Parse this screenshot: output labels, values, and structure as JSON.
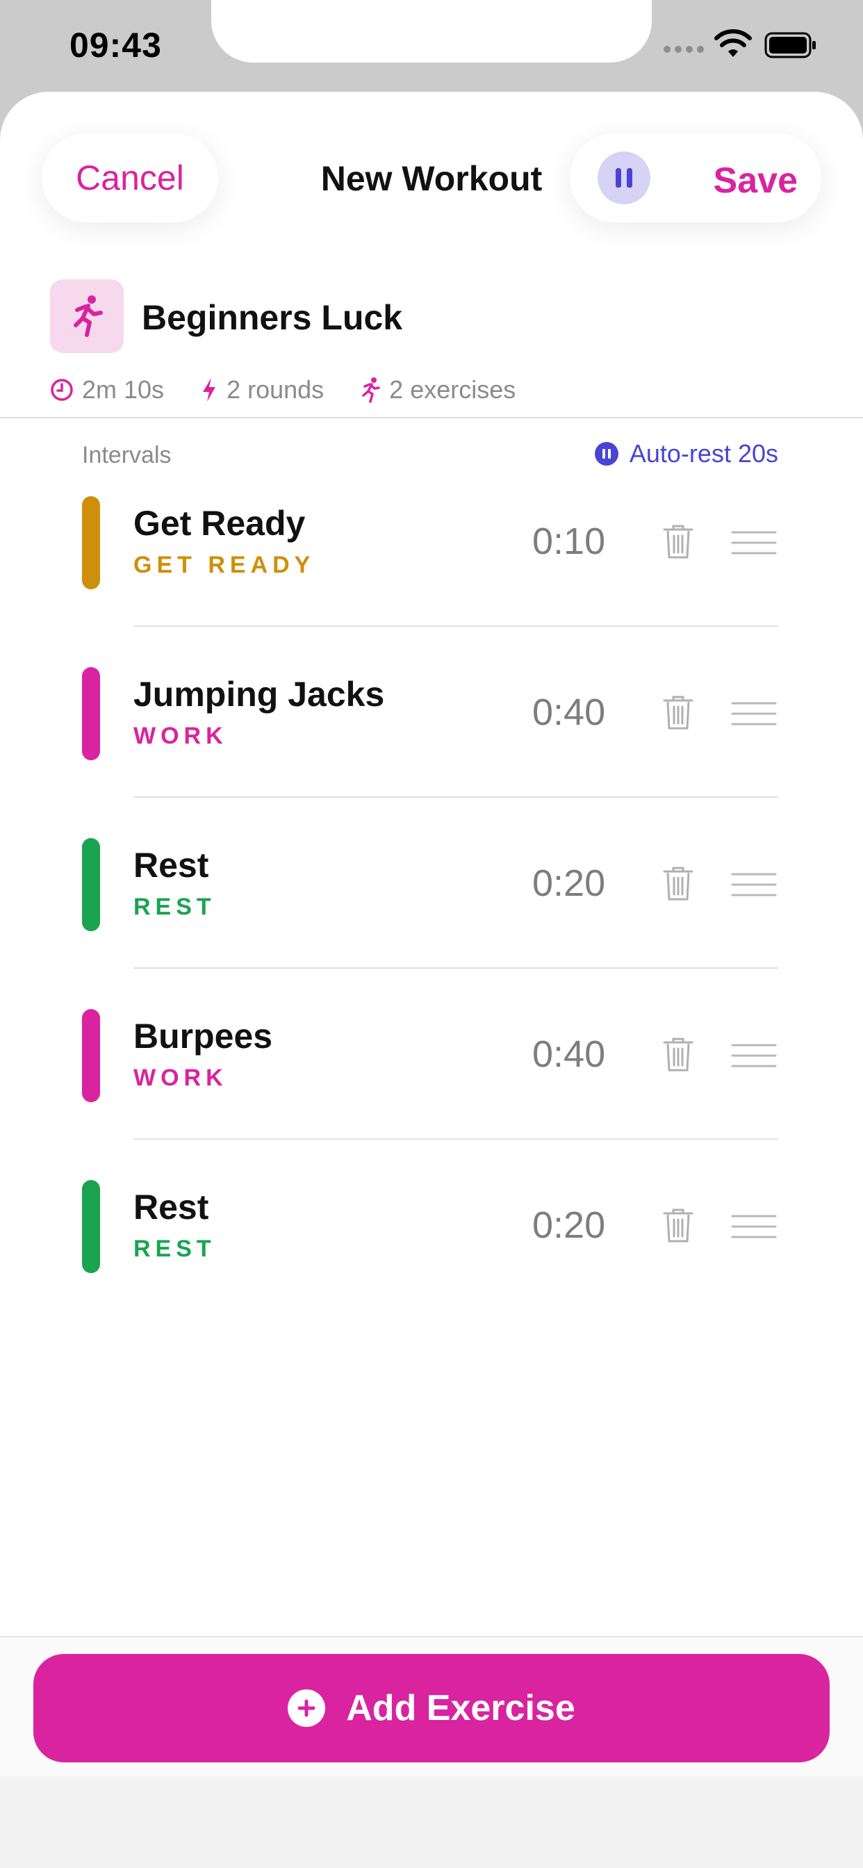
{
  "status_bar": {
    "time": "09:43"
  },
  "nav": {
    "cancel_label": "Cancel",
    "title": "New Workout",
    "save_label": "Save"
  },
  "workout": {
    "name": "Beginners Luck",
    "duration": "2m 10s",
    "rounds": "2 rounds",
    "exercises": "2 exercises"
  },
  "intervals": {
    "label": "Intervals",
    "autorest_label": "Auto-rest 20s",
    "items": [
      {
        "name": "Get Ready",
        "kind": "GET READY",
        "time": "0:10",
        "color": "#d08f0a"
      },
      {
        "name": "Jumping Jacks",
        "kind": "WORK",
        "time": "0:40",
        "color": "#d9239f"
      },
      {
        "name": "Rest",
        "kind": "REST",
        "time": "0:20",
        "color": "#1aa351"
      },
      {
        "name": "Burpees",
        "kind": "WORK",
        "time": "0:40",
        "color": "#d9239f"
      },
      {
        "name": "Rest",
        "kind": "REST",
        "time": "0:20",
        "color": "#1aa351"
      }
    ]
  },
  "footer": {
    "add_label": "Add Exercise"
  },
  "colors": {
    "accent": "#d9239f",
    "autorest": "#4a44d4",
    "get_ready": "#d08f0a",
    "rest": "#1aa351"
  }
}
